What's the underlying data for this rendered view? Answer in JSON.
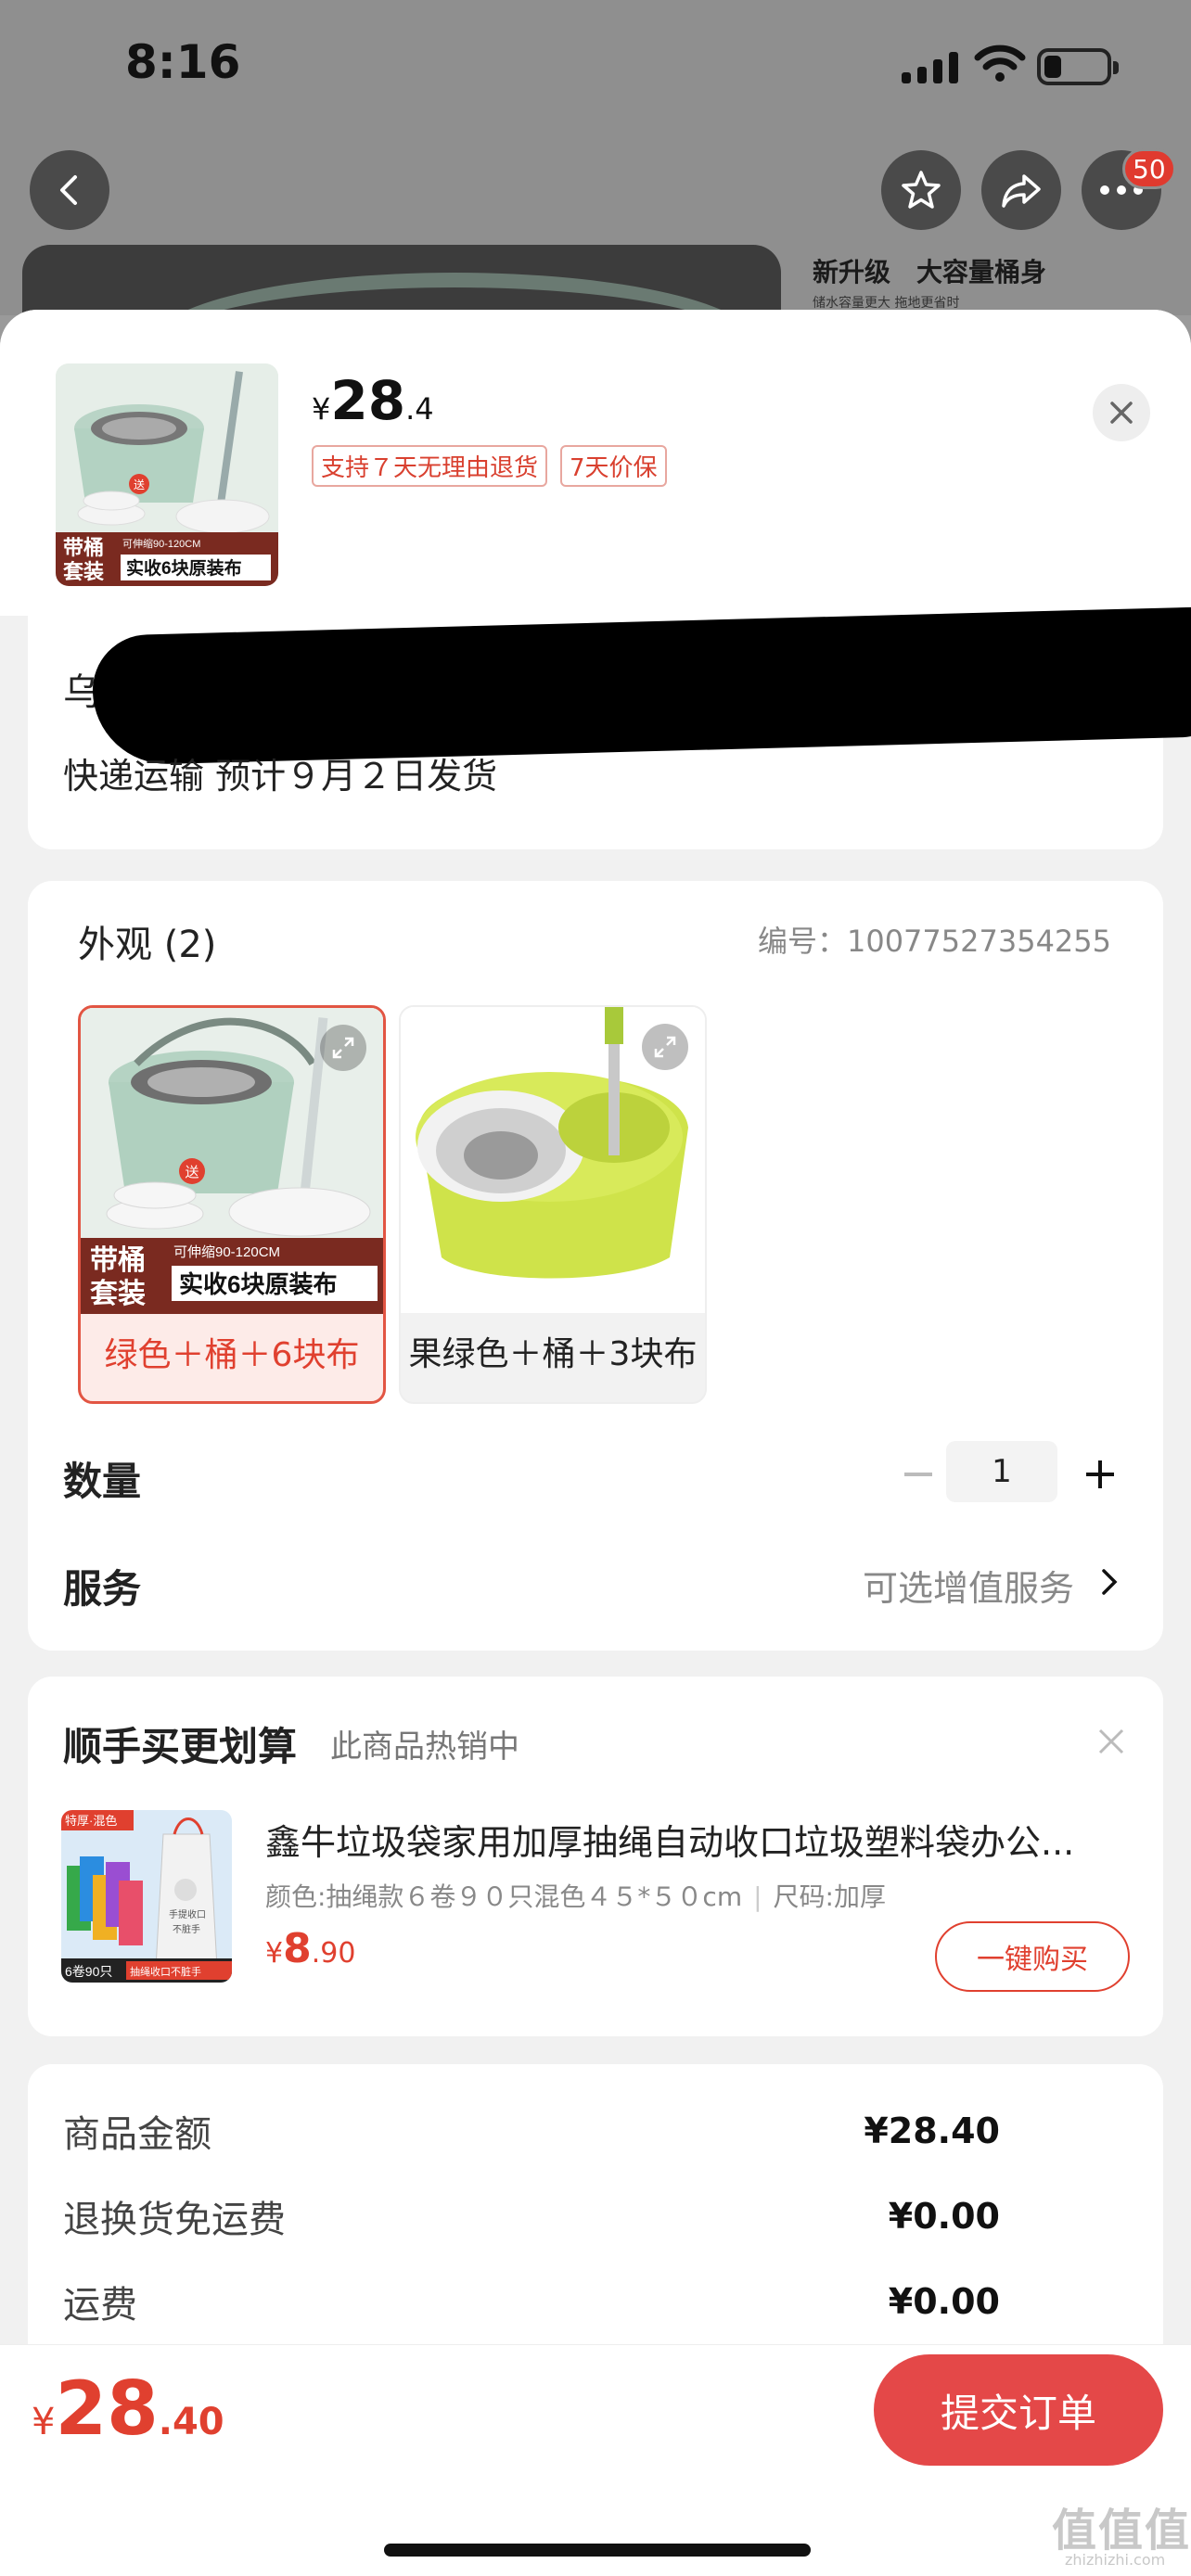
{
  "status_bar": {
    "time": "8:16"
  },
  "background_page": {
    "cart_badge": "50",
    "promo_title": "新升级　大容量桶身",
    "promo_sub": "储水容量更大 拖地更省时"
  },
  "header": {
    "price": {
      "currency": "¥",
      "int": "28",
      "dec": ".4"
    },
    "tags": [
      "支持７天无理由退货",
      "7天价保"
    ],
    "thumb_text": {
      "line1": "带桶",
      "line2": "套装",
      "spec": "可伸缩90-120CM",
      "promo": "实收6块原装布",
      "gift": "送"
    }
  },
  "address": {
    "first_visible": "乌",
    "shipping": "快递运输 预计９月２日发货"
  },
  "options": {
    "title": "外观 (2)",
    "code_label": "编号：",
    "code_value": "10077527354255",
    "variants": [
      {
        "label": "绿色＋桶＋6块布",
        "selected": true,
        "img_text": {
          "line1": "带桶",
          "line2": "套装",
          "spec": "可伸缩90-120CM",
          "promo": "实收6块原装布",
          "gift": "送"
        }
      },
      {
        "label": "果绿色＋桶＋3块布",
        "selected": false
      }
    ],
    "quantity_label": "数量",
    "quantity_value": "1",
    "service_label": "服务",
    "service_hint": "可选增值服务"
  },
  "upsell": {
    "title": "顺手买更划算",
    "subtitle": "此商品热销中",
    "item_name": "鑫牛垃圾袋家用加厚抽绳自动收口垃圾塑料袋办公...",
    "spec_color": "颜色:抽绳款６卷９０只混色４５*５０cm",
    "spec_size": "尺码:加厚",
    "price": {
      "currency": "¥",
      "int": "8",
      "dec": ".90"
    },
    "buy_button": "一键购买",
    "thumb_text": {
      "top": "特厚·混色",
      "bottom_left": "6卷90只",
      "bottom_right": "抽绳收口不脏手",
      "bag1": "手提收口",
      "bag2": "不脏手"
    }
  },
  "totals": [
    {
      "label": "商品金额",
      "value": "¥28.40"
    },
    {
      "label": "退换货免运费",
      "value": "¥0.00"
    },
    {
      "label": "运费",
      "value": "¥0.00"
    }
  ],
  "footer": {
    "total": {
      "currency": "¥",
      "int": "28",
      "dec": ".40"
    },
    "submit": "提交订单"
  },
  "watermark": {
    "main": "值值值",
    "sub": "zhizhizhi.com"
  },
  "colors": {
    "accent": "#e44848",
    "price_red": "#e0402f"
  }
}
